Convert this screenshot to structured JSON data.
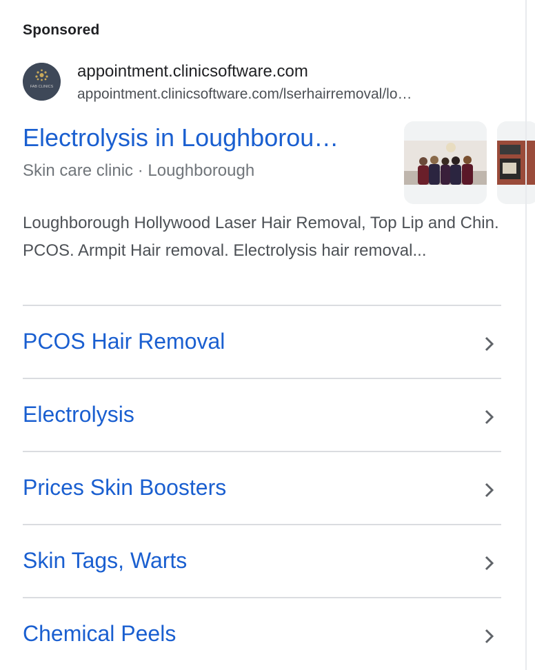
{
  "sponsored_label": "Sponsored",
  "advertiser": {
    "site_name": "appointment.clinicsoftware.com",
    "display_url": "appointment.clinicsoftware.com/lserhairremoval/lo…",
    "favicon_icon": "clinic-logo-icon",
    "favicon_text": "FAB CLINICS"
  },
  "ad": {
    "title": "Electrolysis in Loughborou…",
    "subtitle": "Skin care clinic · Loughborough",
    "description": "Loughborough Hollywood Laser Hair Removal, Top Lip and Chin. PCOS. Armpit Hair removal. Electrolysis hair removal..."
  },
  "sitelinks": [
    {
      "label": "PCOS Hair Removal"
    },
    {
      "label": "Electrolysis"
    },
    {
      "label": "Prices Skin Boosters"
    },
    {
      "label": "Skin Tags, Warts"
    },
    {
      "label": "Chemical Peels"
    }
  ],
  "colors": {
    "link_blue": "#1a5fd0",
    "text_dark": "#202124",
    "text_gray": "#4d5156",
    "divider": "#dadce0"
  }
}
